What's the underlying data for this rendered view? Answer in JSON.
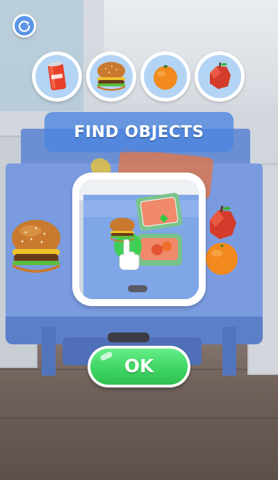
{
  "header": {
    "restart_icon": "restart-icon"
  },
  "targets": [
    {
      "name": "soda-can",
      "icon": "soda-can-icon"
    },
    {
      "name": "burger",
      "icon": "burger-icon"
    },
    {
      "name": "orange",
      "icon": "orange-icon"
    },
    {
      "name": "apple",
      "icon": "apple-icon"
    }
  ],
  "banner": {
    "text": "FIND OBJECTS"
  },
  "tutorial": {
    "icon": "hand-pointer-icon"
  },
  "ok_button": {
    "label": "OK"
  },
  "colors": {
    "accent_blue": "#4a85e0",
    "ok_green": "#3fd563",
    "target_ring": "#b3d4f5"
  }
}
